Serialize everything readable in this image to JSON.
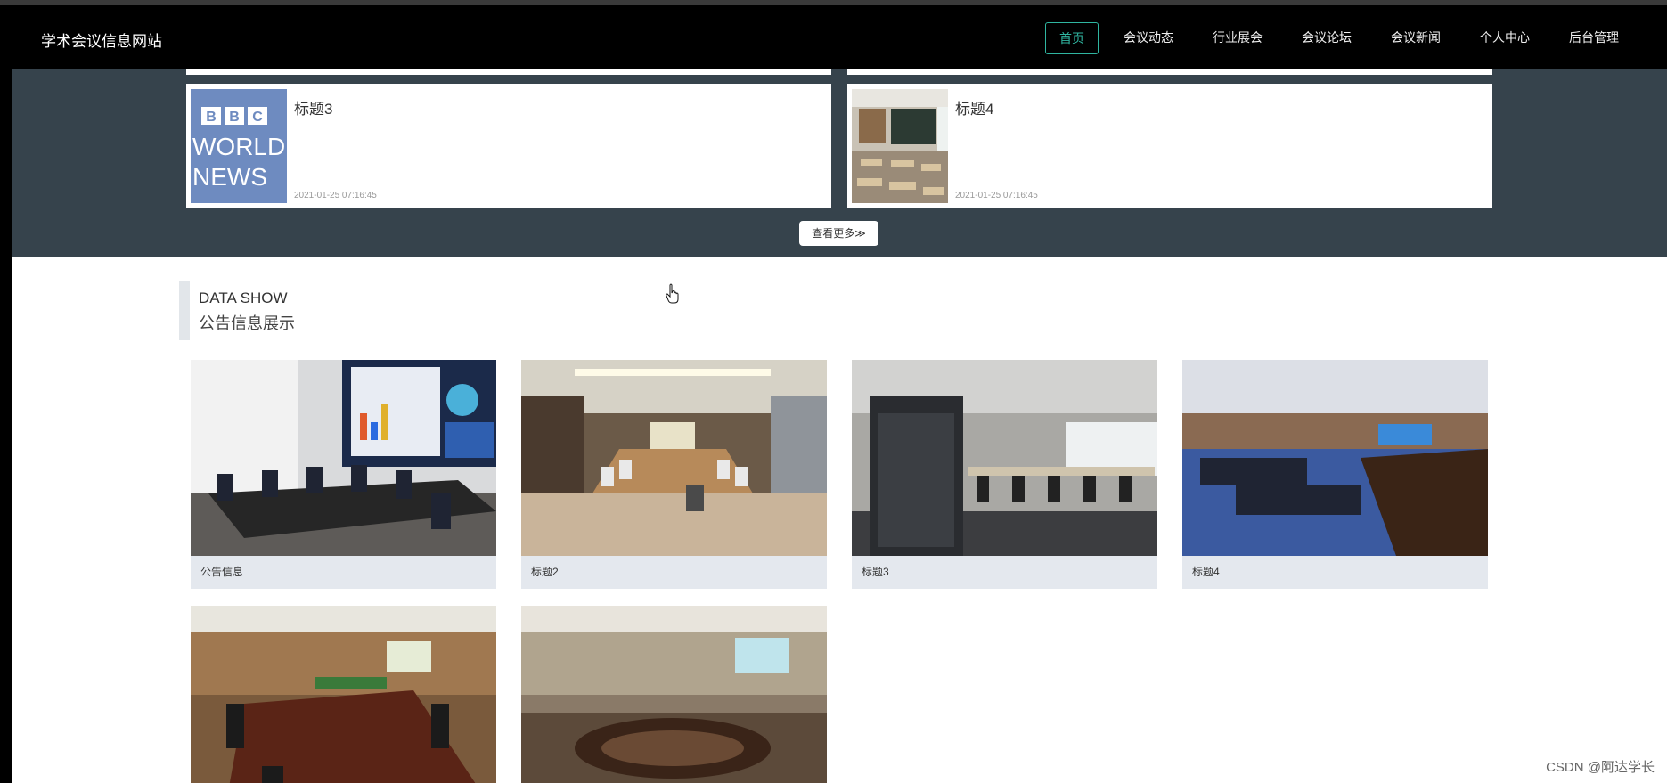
{
  "brand": "学术会议信息网站",
  "nav": [
    {
      "label": "首页",
      "active": true
    },
    {
      "label": "会议动态"
    },
    {
      "label": "行业展会"
    },
    {
      "label": "会议论坛"
    },
    {
      "label": "会议新闻"
    },
    {
      "label": "个人中心"
    },
    {
      "label": "后台管理"
    }
  ],
  "news": [
    {
      "title": "标题3",
      "date": "2021-01-25 07:16:45",
      "thumb": "BBC WORLD NEWS"
    },
    {
      "title": "标题4",
      "date": "2021-01-25 07:16:45"
    }
  ],
  "more_label": "查看更多≫",
  "section": {
    "en": "DATA SHOW",
    "cn": "公告信息展示"
  },
  "notices": [
    {
      "caption": "公告信息"
    },
    {
      "caption": "标题2"
    },
    {
      "caption": "标题3"
    },
    {
      "caption": "标题4"
    }
  ],
  "watermark": "CSDN @阿达学长",
  "colors": {
    "accent": "#2fb5a0",
    "band": "#36434c",
    "caption_bg": "#e4e8ee"
  }
}
